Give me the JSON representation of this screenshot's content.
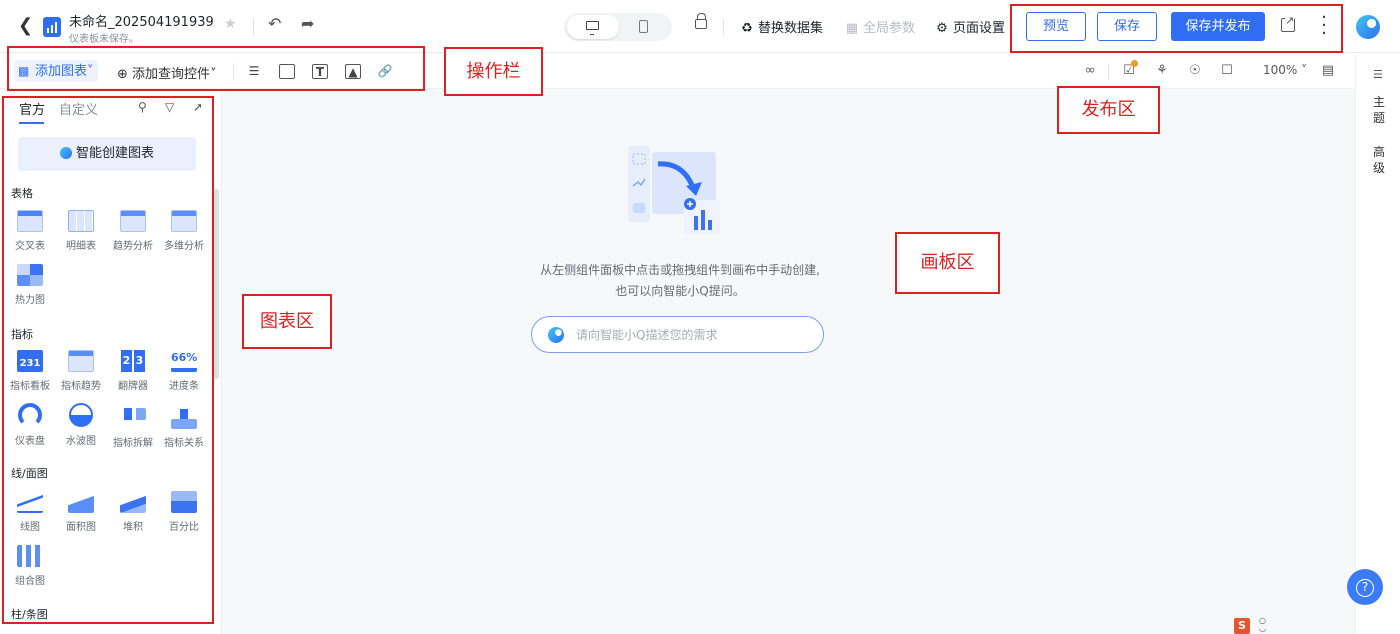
{
  "header": {
    "title": "未命名_202504191939",
    "subtitle": "仪表板未保存。",
    "replace_dataset": "替换数据集",
    "global_params": "全局参数",
    "page_settings": "页面设置",
    "preview": "预览",
    "save": "保存",
    "save_publish": "保存并发布"
  },
  "toolbar": {
    "add_chart": "添加图表",
    "add_query_control": "添加查询控件",
    "zoom": "100%"
  },
  "left_panel": {
    "tab_official": "官方",
    "tab_custom": "自定义",
    "smart_create": "智能创建图表",
    "sections": {
      "table": "表格",
      "indicator": "指标",
      "line_area": "线/面图",
      "bar": "柱/条图"
    },
    "table_items": [
      "交叉表",
      "明细表",
      "趋势分析",
      "多维分析",
      "热力图"
    ],
    "indicator_items": [
      "指标看板",
      "指标趋势",
      "翻牌器",
      "进度条",
      "仪表盘",
      "水波图",
      "指标拆解",
      "指标关系"
    ],
    "indicator_thumbs": {
      "kpi": "231",
      "flip_a": "2",
      "flip_b": "3",
      "pct": "66%"
    },
    "line_items": [
      "线图",
      "面积图",
      "堆积",
      "百分比",
      "组合图"
    ]
  },
  "canvas": {
    "empty_line1": "从左侧组件面板中点击或拖拽组件到画布中手动创建,",
    "empty_line2": "也可以向智能小Q提问。",
    "ask_placeholder": "请向智能小Q描述您的需求"
  },
  "right_rail": {
    "theme": "主题",
    "advanced": "高级"
  },
  "annotations": {
    "toolbar": "操作栏",
    "publish": "发布区",
    "canvas": "画板区",
    "chart": "图表区"
  },
  "colors": {
    "accent": "#2f6ef5",
    "annotation": "#e02020"
  }
}
